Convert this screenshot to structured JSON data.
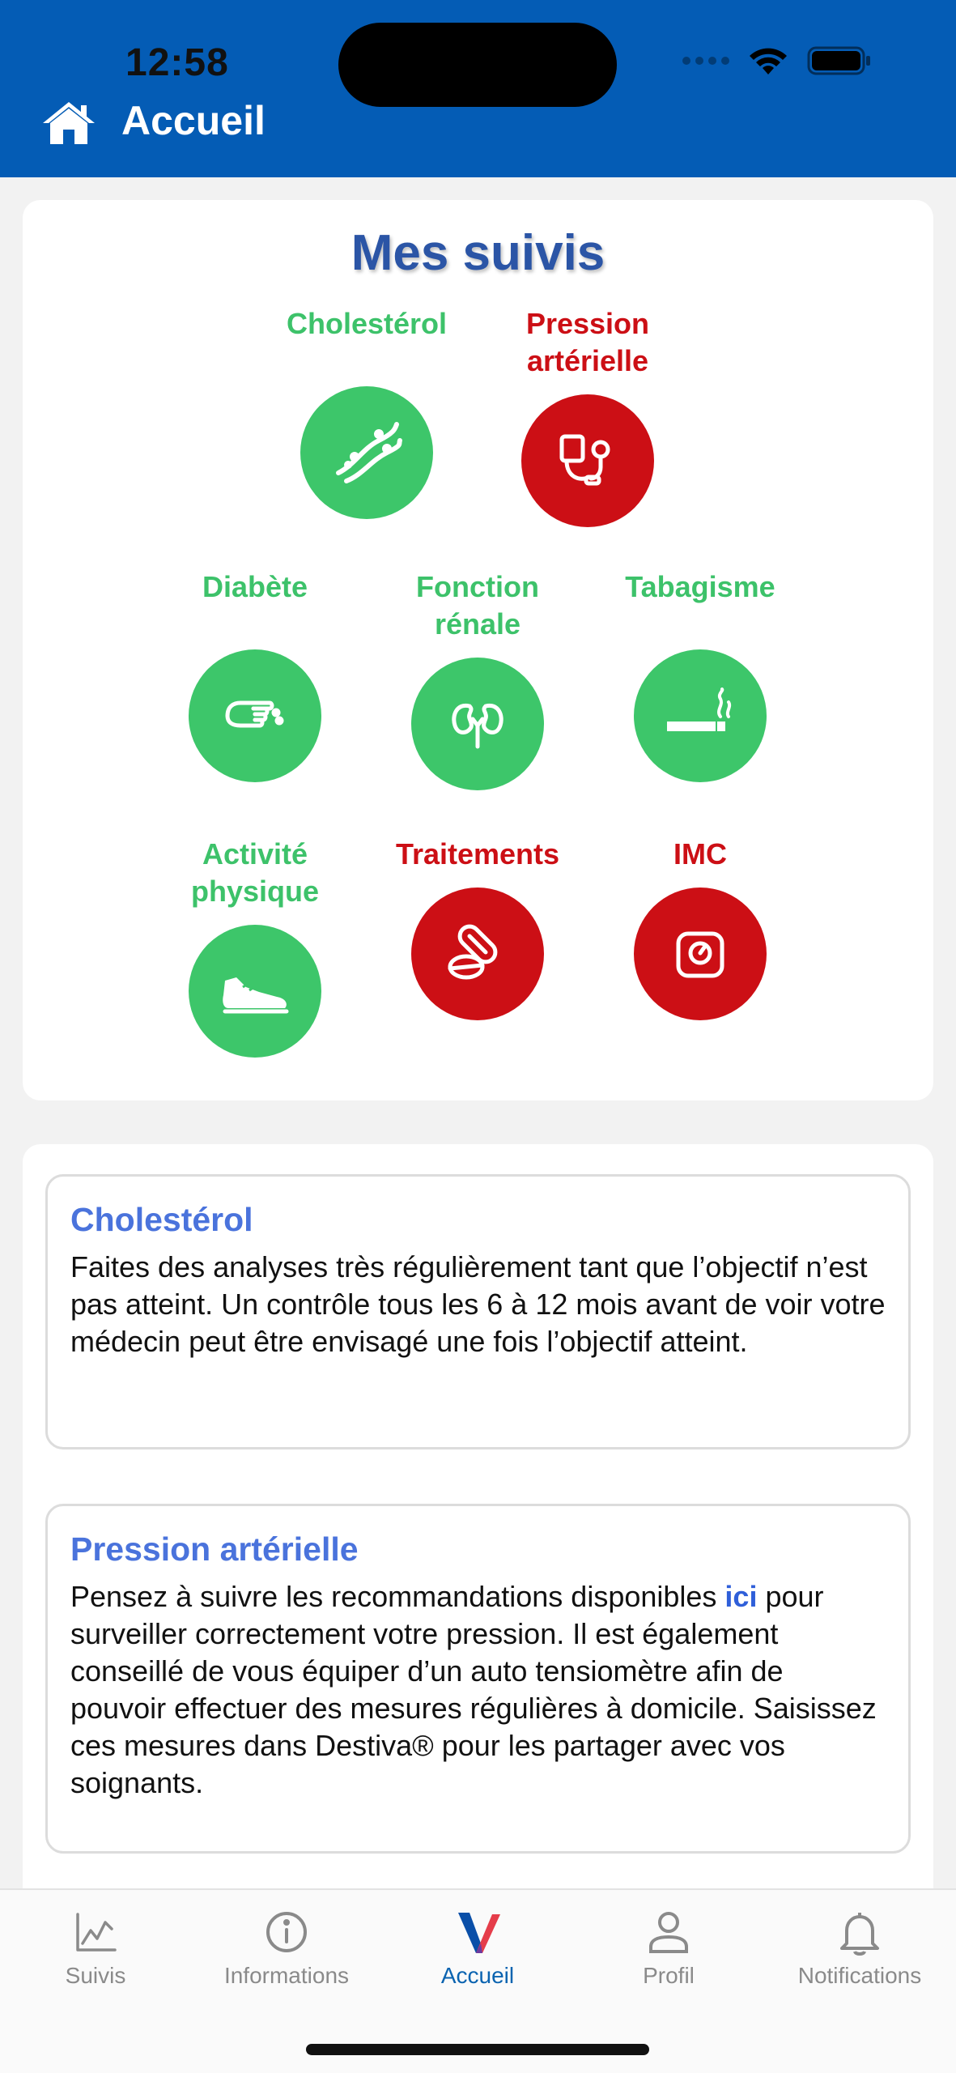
{
  "status_bar": {
    "time": "12:58"
  },
  "header": {
    "title": "Accueil",
    "icon": "home-icon",
    "background": "#045cb5"
  },
  "suivis": {
    "title": "Mes suivis",
    "items": [
      {
        "label": "Cholestérol",
        "icon": "blood-vessel-icon",
        "status": "green"
      },
      {
        "label": "Pression artérielle",
        "icon": "blood-pressure-monitor-icon",
        "status": "red"
      },
      {
        "label": "Diabète",
        "icon": "finger-glucose-icon",
        "status": "green"
      },
      {
        "label": "Fonction rénale",
        "icon": "kidney-icon",
        "status": "green"
      },
      {
        "label": "Tabagisme",
        "icon": "cigarette-icon",
        "status": "green"
      },
      {
        "label": "Activité physique",
        "icon": "sneaker-icon",
        "status": "green"
      },
      {
        "label": "Traitements",
        "icon": "pills-icon",
        "status": "red"
      },
      {
        "label": "IMC",
        "icon": "scale-icon",
        "status": "red"
      }
    ]
  },
  "info": {
    "cholesterol": {
      "title": "Cholestérol",
      "text": "Faites des analyses très régulièrement tant que l’objectif n’est pas atteint. Un contrôle tous les 6 à 12 mois avant de voir votre médecin peut être envisagé une fois l’objectif atteint."
    },
    "pression": {
      "title": "Pression artérielle",
      "text_before": "Pensez à suivre les recommandations disponibles ",
      "link": "ici",
      "text_after": " pour surveiller correctement votre pression. Il est également conseillé de vous équiper d’un auto tensiomètre afin de pouvoir effectuer des mesures régulières à domicile. Saisissez ces mesures dans Destiva® pour les partager avec vos soignants."
    }
  },
  "tabbar": {
    "tabs": [
      {
        "label": "Suivis",
        "icon": "chart-icon",
        "active": false
      },
      {
        "label": "Informations",
        "icon": "info-icon",
        "active": false
      },
      {
        "label": "Accueil",
        "icon": "v-logo-icon",
        "active": true
      },
      {
        "label": "Profil",
        "icon": "person-icon",
        "active": false
      },
      {
        "label": "Notifications",
        "icon": "bell-icon",
        "active": false
      }
    ]
  },
  "colors": {
    "green": "#3dc66a",
    "red": "#cc0f15",
    "accent": "#0a63b0",
    "title_blue": "#2b55a6"
  }
}
